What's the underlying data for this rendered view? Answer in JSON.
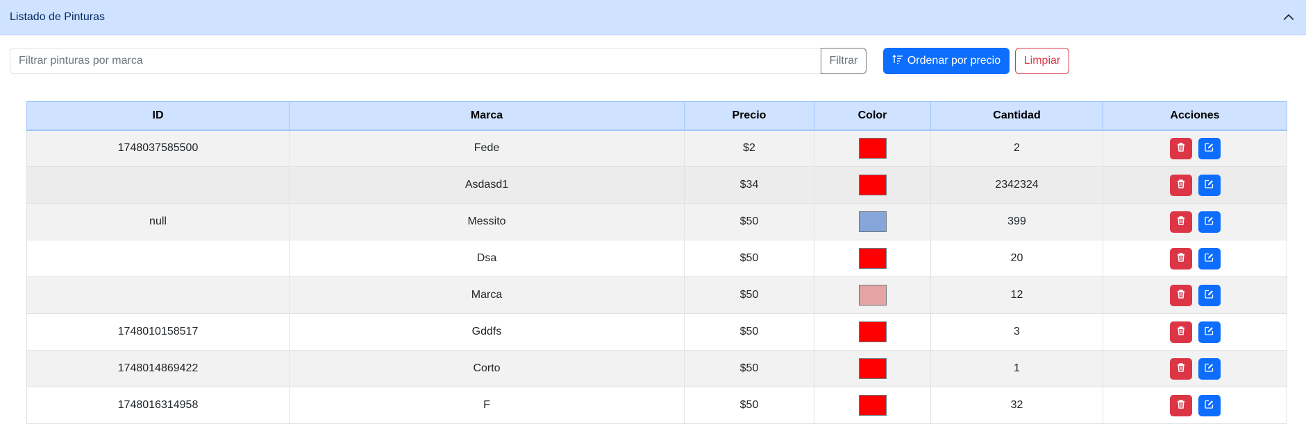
{
  "accordion": {
    "title": "Listado de Pinturas"
  },
  "filter": {
    "placeholder": "Filtrar pinturas por marca",
    "value": "",
    "button_label": "Filtrar"
  },
  "sort_button": {
    "label": "Ordenar por precio"
  },
  "clear_button": {
    "label": "Limpiar"
  },
  "colors": {
    "accent": "#0d6efd",
    "danger": "#dc3545",
    "header_bg": "#cfe2ff"
  },
  "table": {
    "headers": [
      "ID",
      "Marca",
      "Precio",
      "Color",
      "Cantidad",
      "Acciones"
    ],
    "rows": [
      {
        "id": "1748037585500",
        "marca": "Fede",
        "precio": "$2",
        "color": "#ff0000",
        "cantidad": "2"
      },
      {
        "id": "",
        "marca": "Asdasd1",
        "precio": "$34",
        "color": "#ff0000",
        "cantidad": "2342324"
      },
      {
        "id": "null",
        "marca": "Messito",
        "precio": "$50",
        "color": "#86a5d9",
        "cantidad": "399"
      },
      {
        "id": "",
        "marca": "Dsa",
        "precio": "$50",
        "color": "#ff0000",
        "cantidad": "20"
      },
      {
        "id": "",
        "marca": "Marca",
        "precio": "$50",
        "color": "#e4a4a4",
        "cantidad": "12"
      },
      {
        "id": "1748010158517",
        "marca": "Gddfs",
        "precio": "$50",
        "color": "#ff0000",
        "cantidad": "3"
      },
      {
        "id": "1748014869422",
        "marca": "Corto",
        "precio": "$50",
        "color": "#ff0000",
        "cantidad": "1"
      },
      {
        "id": "1748016314958",
        "marca": "F",
        "precio": "$50",
        "color": "#ff0000",
        "cantidad": "32"
      }
    ],
    "row_action_icons": {
      "delete": "trash-icon",
      "edit": "edit-icon"
    }
  }
}
